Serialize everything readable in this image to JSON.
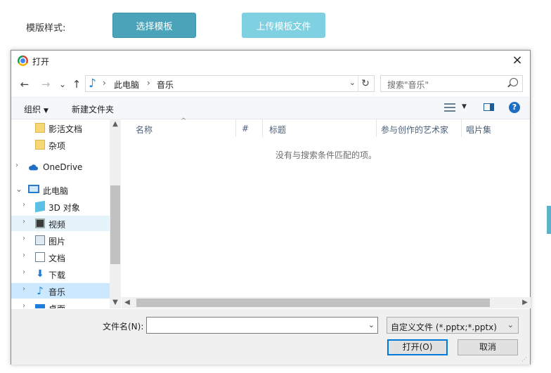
{
  "page": {
    "label": "模版样式:",
    "select_template_button": "选择模板",
    "upload_template_button": "上传模板文件"
  },
  "dialog": {
    "title": "打开",
    "close_glyph": "×",
    "nav": {
      "back": "←",
      "forward": "→",
      "recent": "⌄",
      "up": "↑"
    },
    "address": {
      "crumbs": [
        "此电脑",
        "音乐"
      ],
      "separator": "›",
      "dropdown": "⌄",
      "refresh": "↻"
    },
    "search": {
      "placeholder": "搜索\"音乐\""
    },
    "toolbar": {
      "organize": "组织",
      "organize_caret": "▼",
      "new_folder": "新建文件夹",
      "view_caret": "▼",
      "help": "?"
    },
    "tree": [
      {
        "label": "影活文档",
        "icon": "folder-icon",
        "expander": ""
      },
      {
        "label": "杂项",
        "icon": "folder-icon",
        "expander": ""
      },
      {
        "label": "OneDrive",
        "icon": "cloud-icon",
        "expander": "›"
      },
      {
        "label": "此电脑",
        "icon": "computer-icon",
        "expander": "⌄"
      },
      {
        "label": "3D 对象",
        "icon": "3d-objects-icon",
        "expander": "›"
      },
      {
        "label": "视频",
        "icon": "video-icon",
        "expander": "›",
        "state": "hover"
      },
      {
        "label": "图片",
        "icon": "pictures-icon",
        "expander": "›"
      },
      {
        "label": "文档",
        "icon": "documents-icon",
        "expander": "›"
      },
      {
        "label": "下载",
        "icon": "download-icon",
        "expander": "›"
      },
      {
        "label": "音乐",
        "icon": "music-icon",
        "expander": "›",
        "state": "selected"
      },
      {
        "label": "桌面",
        "icon": "desktop-icon",
        "expander": "›"
      }
    ],
    "columns": [
      "名称",
      "#",
      "标题",
      "参与创作的艺术家",
      "唱片集"
    ],
    "sort_indicator": "^",
    "empty_message": "没有与搜索条件匹配的项。",
    "scroll": {
      "up": "▲",
      "down": "▼",
      "left": "◀",
      "right": "▶"
    },
    "filename_label": "文件名(N):",
    "filename_value": "",
    "filename_dropdown": "⌄",
    "filetype_value": "自定义文件 (*.pptx;*.pptx)",
    "filetype_dropdown": "⌄",
    "open_button": "打开(O)",
    "cancel_button": "取消",
    "grip": "⋰",
    "colors": {
      "accent": "#0078d7",
      "teal_button": "#4aa3b8",
      "teal_light": "#7fd0e0",
      "selected_row": "#cce8ff"
    }
  }
}
